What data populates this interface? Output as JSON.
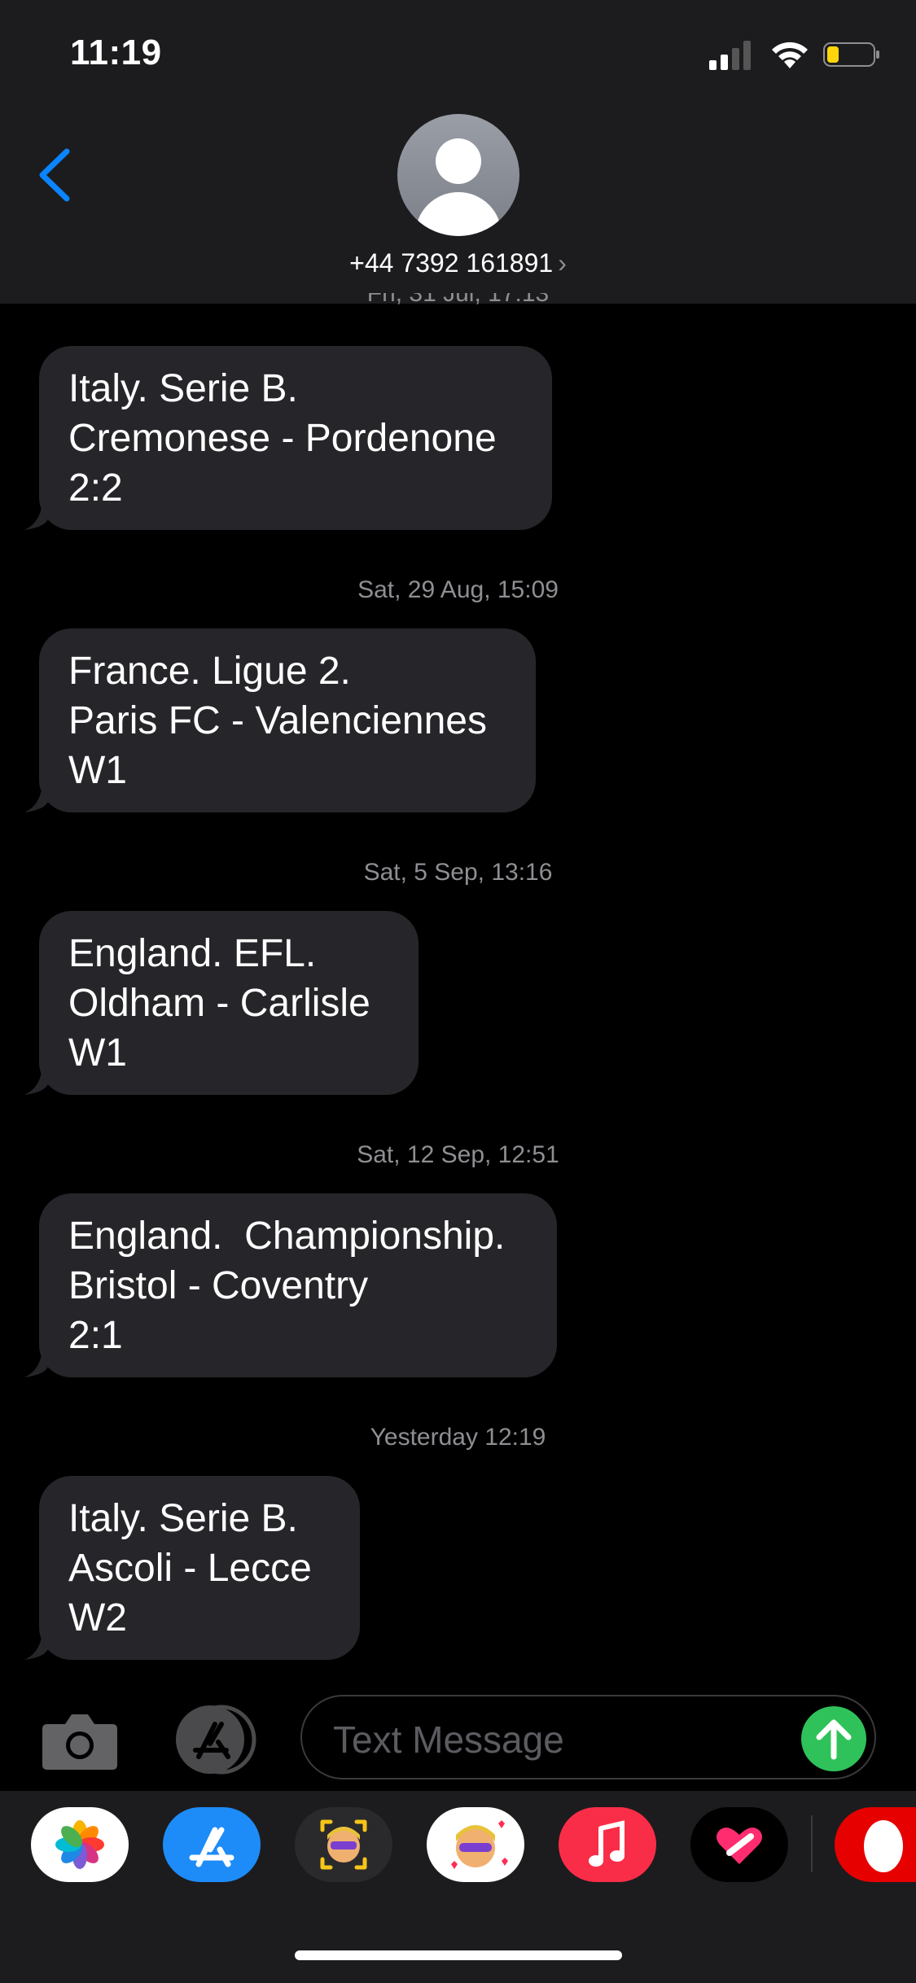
{
  "status_bar": {
    "time": "11:19"
  },
  "header": {
    "contact_number": "+44 7392 161891",
    "chevron": "›"
  },
  "conversation": {
    "top_timestamp_partial": "Fri, 31 Jul, 17:13",
    "messages": [
      {
        "lines": [
          "Italy. Serie B.",
          "Cremonese - Pordenone",
          "2:2"
        ]
      },
      {
        "timestamp": "Sat, 29 Aug, 15:09",
        "lines": [
          "France. Ligue 2.",
          "Paris FC - Valenciennes",
          "W1"
        ]
      },
      {
        "timestamp": "Sat, 5 Sep, 13:16",
        "lines": [
          "England. EFL.",
          "Oldham - Carlisle",
          "W1"
        ]
      },
      {
        "timestamp": "Sat, 12 Sep, 12:51",
        "lines": [
          "England.  Championship.",
          "Bristol - Coventry",
          "2:1"
        ]
      },
      {
        "timestamp": "Yesterday 12:19",
        "lines": [
          "Italy. Serie B.",
          "Ascoli - Lecce",
          "W2"
        ]
      }
    ]
  },
  "composer": {
    "placeholder": "Text Message"
  },
  "app_drawer": {
    "apps": [
      "photos-app-icon",
      "app-store-icon",
      "memoji-app-icon",
      "memoji-stickers-icon",
      "music-app-icon",
      "digital-touch-icon",
      "extra-app-icon"
    ]
  },
  "colors": {
    "accent": "#0a84ff",
    "bubble": "#26262a",
    "send": "#30c25a"
  }
}
